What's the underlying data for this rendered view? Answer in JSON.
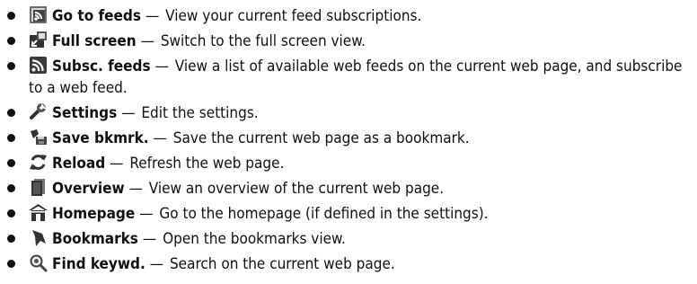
{
  "items": [
    {
      "icon": "go-to-feeds-icon",
      "term": "Go to feeds",
      "desc": "View your current feed subscriptions."
    },
    {
      "icon": "full-screen-icon",
      "term": "Full screen",
      "desc": "Switch to the full screen view."
    },
    {
      "icon": "rss-feed-icon",
      "term": "Subsc. feeds",
      "desc": "View a list of available web feeds on the current web page, and subscribe to a web feed."
    },
    {
      "icon": "wrench-icon",
      "term": "Settings",
      "desc": "Edit the settings."
    },
    {
      "icon": "save-bookmark-icon",
      "term": "Save bkmrk.",
      "desc": "Save the current web page as a bookmark."
    },
    {
      "icon": "reload-icon",
      "term": "Reload",
      "desc": "Refresh the web page."
    },
    {
      "icon": "overview-icon",
      "term": "Overview",
      "desc": "View an overview of the current web page."
    },
    {
      "icon": "home-icon",
      "term": "Homepage",
      "desc": "Go to the homepage (if defined in the settings)."
    },
    {
      "icon": "bookmark-icon",
      "term": "Bookmarks",
      "desc": "Open the bookmarks view."
    },
    {
      "icon": "find-keyword-icon",
      "term": "Find keywd.",
      "desc": "Search on the current web page."
    }
  ],
  "separator": "—"
}
